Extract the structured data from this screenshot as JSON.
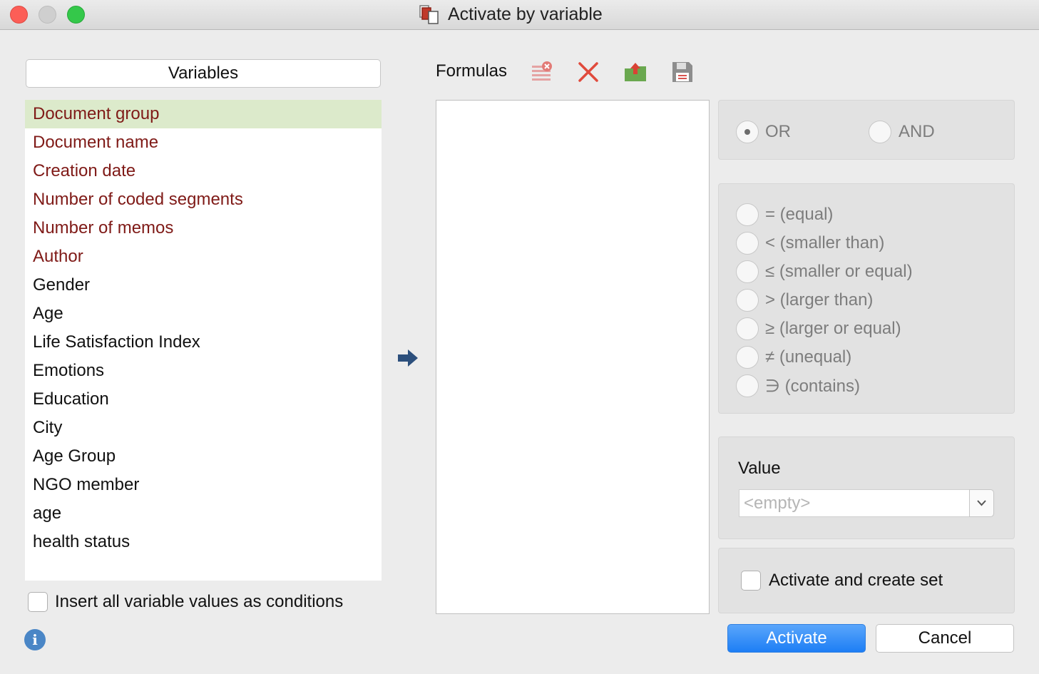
{
  "window": {
    "title": "Activate by variable"
  },
  "variables": {
    "header": "Variables",
    "items": [
      {
        "label": "Document group",
        "type": "system",
        "selected": true
      },
      {
        "label": "Document name",
        "type": "system"
      },
      {
        "label": "Creation date",
        "type": "system"
      },
      {
        "label": "Number of coded segments",
        "type": "system"
      },
      {
        "label": "Number of memos",
        "type": "system"
      },
      {
        "label": "Author",
        "type": "system"
      },
      {
        "label": "Gender",
        "type": "user"
      },
      {
        "label": "Age",
        "type": "user"
      },
      {
        "label": "Life Satisfaction Index",
        "type": "user"
      },
      {
        "label": "Emotions",
        "type": "user"
      },
      {
        "label": "Education",
        "type": "user"
      },
      {
        "label": "City",
        "type": "user"
      },
      {
        "label": "Age Group",
        "type": "user"
      },
      {
        "label": "NGO member",
        "type": "user"
      },
      {
        "label": "age",
        "type": "user"
      },
      {
        "label": "health status",
        "type": "user"
      }
    ],
    "insert_all_label": "Insert all variable values as conditions",
    "insert_all_checked": false
  },
  "formulas": {
    "label": "Formulas",
    "tools": [
      "clear-list-icon",
      "delete-icon",
      "open-folder-icon",
      "save-disk-icon"
    ]
  },
  "logic": {
    "or_label": "OR",
    "and_label": "AND",
    "selected": "OR"
  },
  "operators": [
    "= (equal)",
    "< (smaller than)",
    "≤ (smaller or equal)",
    "> (larger than)",
    "≥ (larger or equal)",
    "≠ (unequal)",
    "∋ (contains)"
  ],
  "value": {
    "label": "Value",
    "placeholder": "<empty>"
  },
  "create_set": {
    "label": "Activate and create set",
    "checked": false
  },
  "buttons": {
    "activate": "Activate",
    "cancel": "Cancel"
  },
  "colors": {
    "selected_row": "#dceacb",
    "system_variable": "#7f1a17",
    "primary_button": "#1d7ef5",
    "arrow": "#2c4f7c",
    "delete_icon": "#e04a3c"
  }
}
